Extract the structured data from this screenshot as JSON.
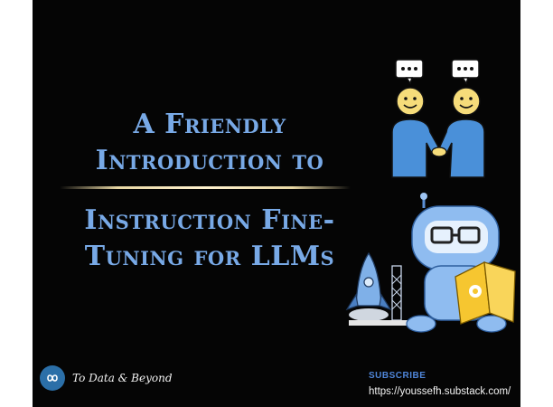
{
  "title": {
    "line1": "A Friendly",
    "line2": "Introduction to",
    "line3": "Instruction Fine-",
    "line4": "Tuning for LLMs"
  },
  "branding": {
    "logo_icon": "infinity-logo-icon",
    "name": "To Data & Beyond"
  },
  "subscribe": {
    "label": "SUBSCRIBE",
    "url": "https://youssefh.substack.com/"
  },
  "illustrations": [
    "handshake-people-icon",
    "robot-reading-book-icon",
    "rocket-icon"
  ],
  "colors": {
    "background": "#050505",
    "title": "#78a9e6",
    "accent_blue": "#4f86d9",
    "divider": "#f0e2b6"
  }
}
